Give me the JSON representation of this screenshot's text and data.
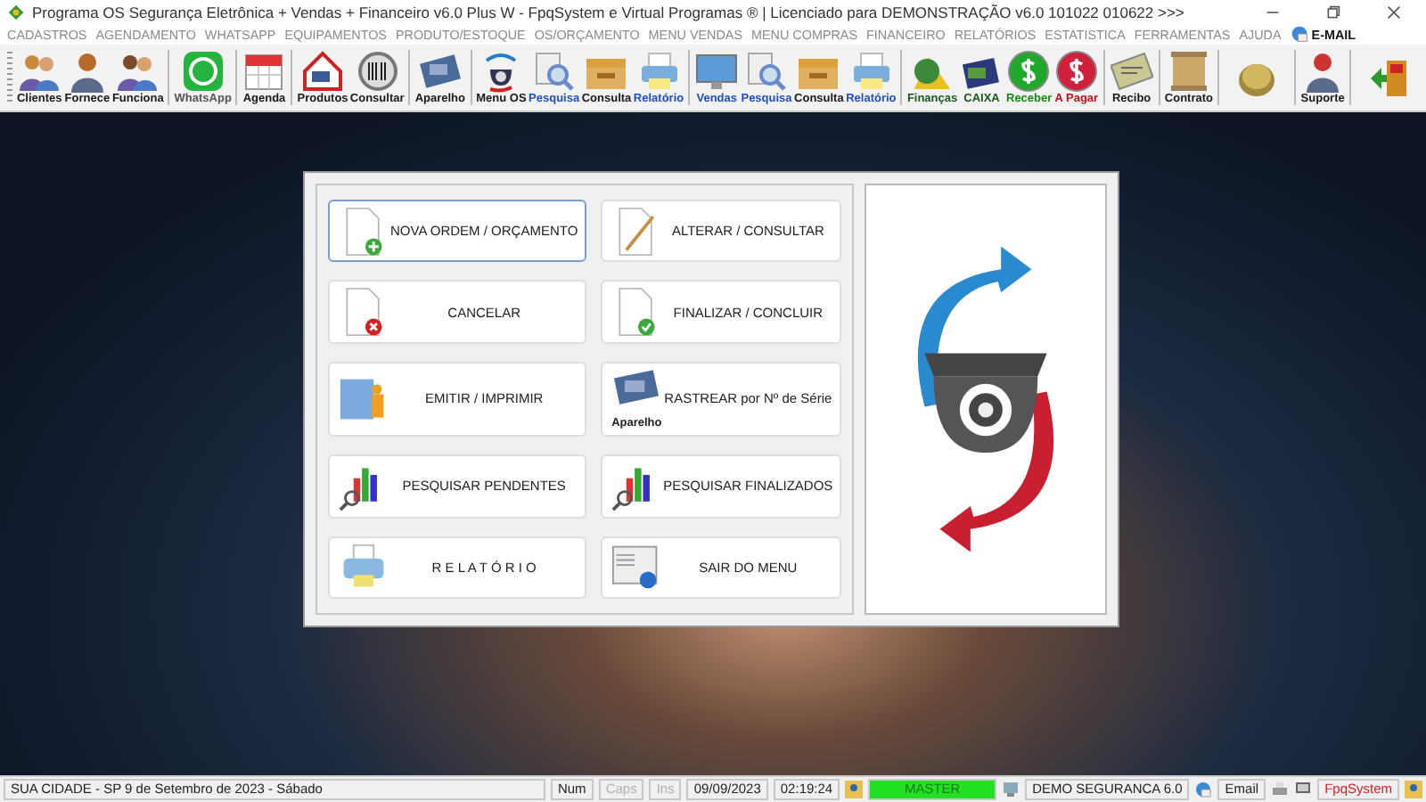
{
  "window": {
    "title": "Programa OS Segurança Eletrônica + Vendas + Financeiro v6.0 Plus W - FpqSystem e Virtual Programas ® | Licenciado para  DEMONSTRAÇÃO v6.0 101022 010622 >>>"
  },
  "menu": [
    {
      "label": "CADASTROS",
      "kind": "text"
    },
    {
      "label": "AGENDAMENTO",
      "kind": "text"
    },
    {
      "label": "WHATSAPP",
      "kind": "text"
    },
    {
      "label": "EQUIPAMENTOS",
      "kind": "text"
    },
    {
      "label": "PRODUTO/ESTOQUE",
      "kind": "text"
    },
    {
      "label": "OS/ORÇAMENTO",
      "kind": "text"
    },
    {
      "label": "MENU VENDAS",
      "kind": "text"
    },
    {
      "label": "MENU COMPRAS",
      "kind": "text"
    },
    {
      "label": "FINANCEIRO",
      "kind": "text"
    },
    {
      "label": "RELATÓRIOS",
      "kind": "text"
    },
    {
      "label": "ESTATISTICA",
      "kind": "text"
    },
    {
      "label": "FERRAMENTAS",
      "kind": "text"
    },
    {
      "label": "AJUDA",
      "kind": "text"
    },
    {
      "label": "E-MAIL",
      "kind": "icon"
    }
  ],
  "toolbar": [
    [
      {
        "label": "Clientes",
        "color": "#1a1a1a"
      },
      {
        "label": "Fornece",
        "color": "#1a1a1a"
      },
      {
        "label": "Funciona",
        "color": "#1a1a1a"
      }
    ],
    [
      {
        "label": "WhatsApp",
        "color": "#555555"
      }
    ],
    [
      {
        "label": "Agenda",
        "color": "#1a1a1a"
      }
    ],
    [
      {
        "label": "Produtos",
        "color": "#1a1a1a"
      },
      {
        "label": "Consultar",
        "color": "#1a1a1a"
      }
    ],
    [
      {
        "label": "Aparelho",
        "color": "#1a1a1a"
      }
    ],
    [
      {
        "label": "Menu OS",
        "color": "#1a1a1a"
      },
      {
        "label": "Pesquisa",
        "color": "#1f4fbf"
      },
      {
        "label": "Consulta",
        "color": "#1a1a1a"
      },
      {
        "label": "Relatório",
        "color": "#1f4fbf"
      }
    ],
    [
      {
        "label": "Vendas",
        "color": "#1f4fbf"
      },
      {
        "label": "Pesquisa",
        "color": "#1f4fbf"
      },
      {
        "label": "Consulta",
        "color": "#1a1a1a"
      },
      {
        "label": "Relatório",
        "color": "#1f4fbf"
      }
    ],
    [
      {
        "label": "Finanças",
        "color": "#1a5a1a"
      },
      {
        "label": "CAIXA",
        "color": "#1a5a1a"
      },
      {
        "label": "Receber",
        "color": "#138a13"
      },
      {
        "label": "A Pagar",
        "color": "#c0101a"
      }
    ],
    [
      {
        "label": "Recibo",
        "color": "#1a1a1a"
      }
    ],
    [
      {
        "label": "Contrato",
        "color": "#1a1a1a"
      }
    ],
    [
      {
        "kind": "icon"
      }
    ],
    [
      {
        "label": "Suporte",
        "color": "#1a1a1a"
      }
    ],
    [
      {
        "kind": "icon"
      }
    ]
  ],
  "dialog": {
    "buttons": [
      {
        "label": "NOVA ORDEM / ORÇAMENTO",
        "selected": true
      },
      {
        "label": "ALTERAR  /  CONSULTAR",
        "selected": false
      },
      {
        "label": "CANCELAR",
        "selected": false
      },
      {
        "label": "FINALIZAR  /  CONCLUIR",
        "selected": false
      },
      {
        "label": "EMITIR  /  IMPRIMIR",
        "selected": false
      },
      {
        "label": "RASTREAR por Nº de Série",
        "selected": false,
        "icon_caption": "Aparelho"
      },
      {
        "label": "PESQUISAR PENDENTES",
        "selected": false
      },
      {
        "label": "PESQUISAR FINALIZADOS",
        "selected": false
      },
      {
        "label": "R E L A T Ó R I O",
        "selected": false
      },
      {
        "label": "SAIR DO MENU",
        "selected": false
      }
    ]
  },
  "status_bar": {
    "location_date": "SUA CIDADE - SP  9 de Setembro de 2023 - Sábado",
    "keys": [
      {
        "label": "Num",
        "disabled": false
      },
      {
        "label": "Caps",
        "disabled": true
      },
      {
        "label": "Ins",
        "disabled": true
      }
    ],
    "date": "09/09/2023",
    "time": "02:19:24",
    "user": "MASTER",
    "edition": "DEMO SEGURANCA 6.0",
    "email": "Email",
    "brand": "FpqSystem"
  }
}
